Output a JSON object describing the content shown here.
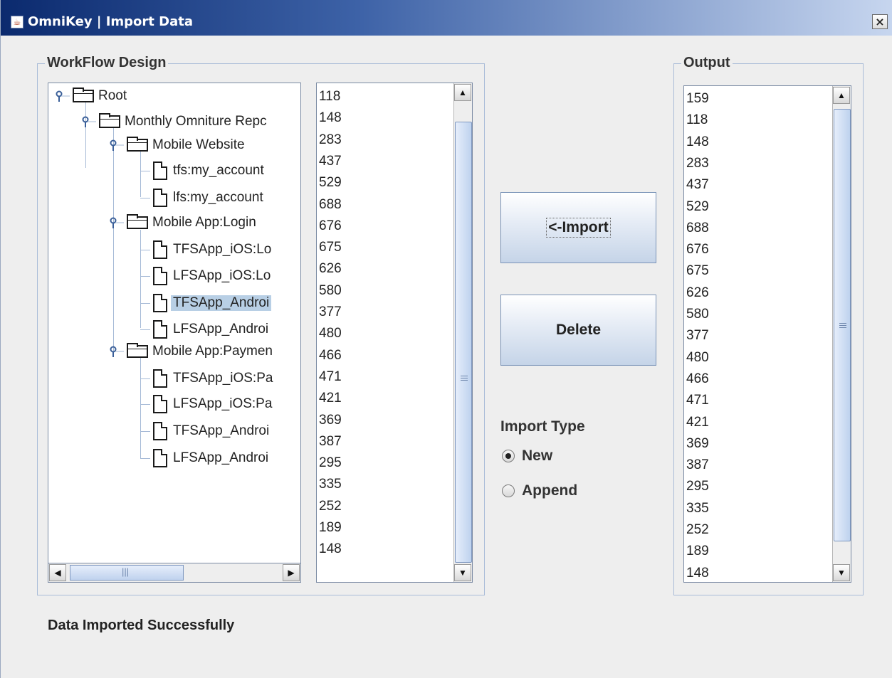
{
  "window": {
    "title": "OmniKey | Import Data",
    "close_label": "×",
    "app_icon": "java-cup-icon"
  },
  "workflow": {
    "group_label": "WorkFlow Design",
    "tree": [
      {
        "label": "Root",
        "type": "folder"
      },
      {
        "label": "Monthly Omniture Repc",
        "type": "folder"
      },
      {
        "label": "Mobile Website",
        "type": "folder"
      },
      {
        "label": "tfs:my_account",
        "type": "file"
      },
      {
        "label": "lfs:my_account",
        "type": "file"
      },
      {
        "label": "Mobile App:Login",
        "type": "folder"
      },
      {
        "label": "TFSApp_iOS:Lo",
        "type": "file"
      },
      {
        "label": "LFSApp_iOS:Lo",
        "type": "file"
      },
      {
        "label": "TFSApp_Androi",
        "type": "file",
        "selected": true
      },
      {
        "label": "LFSApp_Androi",
        "type": "file"
      },
      {
        "label": "Mobile App:Paymen",
        "type": "folder"
      },
      {
        "label": "TFSApp_iOS:Pa",
        "type": "file"
      },
      {
        "label": "LFSApp_iOS:Pa",
        "type": "file"
      },
      {
        "label": "TFSApp_Androi",
        "type": "file"
      },
      {
        "label": "LFSApp_Androi",
        "type": "file"
      }
    ],
    "hscroll": {
      "left_arrow": "◀",
      "right_arrow": "▶",
      "grip": "|||"
    },
    "values": [
      "118",
      "148",
      "283",
      "437",
      "529",
      "688",
      "676",
      "675",
      "626",
      "580",
      "377",
      "480",
      "466",
      "471",
      "421",
      "369",
      "387",
      "295",
      "335",
      "252",
      "189",
      "148"
    ]
  },
  "actions": {
    "import_label": "<-Import",
    "delete_label": "Delete"
  },
  "import_type": {
    "label": "Import Type",
    "options": [
      {
        "label": "New",
        "selected": true
      },
      {
        "label": "Append",
        "selected": false
      }
    ]
  },
  "output": {
    "group_label": "Output",
    "values": [
      "159",
      "118",
      "148",
      "283",
      "437",
      "529",
      "688",
      "676",
      "675",
      "626",
      "580",
      "377",
      "480",
      "466",
      "471",
      "421",
      "369",
      "387",
      "295",
      "335",
      "252",
      "189",
      "148"
    ]
  },
  "scroll": {
    "up_arrow": "▲",
    "down_arrow": "▼"
  },
  "status": {
    "message": "Data Imported Successfully"
  }
}
